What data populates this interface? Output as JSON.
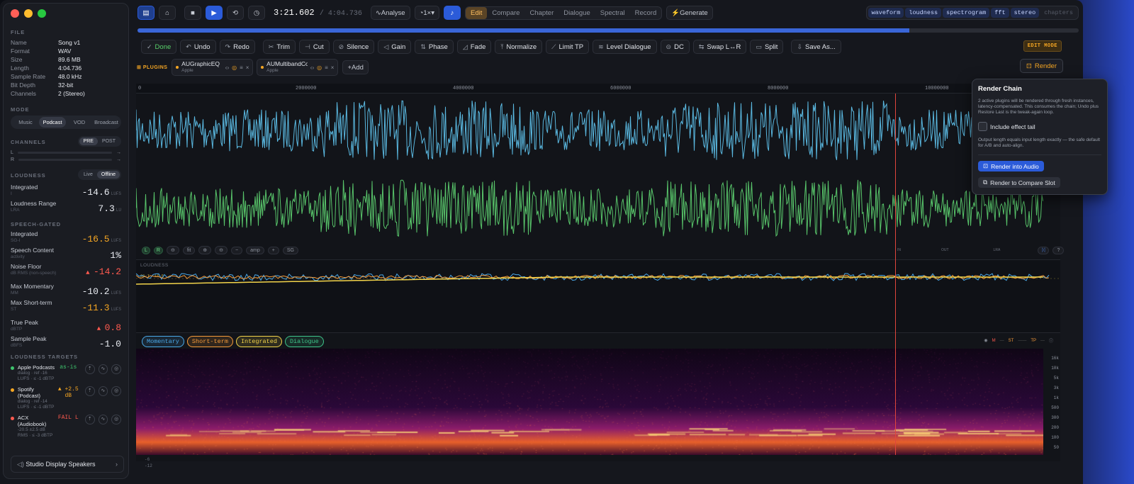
{
  "file": {
    "section": "FILE",
    "rows": [
      {
        "k": "Name",
        "v": "Song v1"
      },
      {
        "k": "Format",
        "v": "WAV"
      },
      {
        "k": "Size",
        "v": "89.6 MB"
      },
      {
        "k": "Length",
        "v": "4:04.736"
      },
      {
        "k": "Sample Rate",
        "v": "48.0 kHz"
      },
      {
        "k": "Bit Depth",
        "v": "32-bit"
      },
      {
        "k": "Channels",
        "v": "2 (Stereo)"
      }
    ]
  },
  "mode": {
    "section": "MODE",
    "options": [
      "Music",
      "Podcast",
      "VOD",
      "Broadcast"
    ],
    "selected": "Podcast"
  },
  "channels": {
    "section": "CHANNELS",
    "pre": "PRE",
    "post": "POST",
    "l": "L",
    "r": "R"
  },
  "loudness": {
    "section": "LOUDNESS",
    "live": "Live",
    "offline": "Offline",
    "integrated": {
      "label": "Integrated",
      "sub": "I",
      "value": "-14.6",
      "unit": "LUFS"
    },
    "range": {
      "label": "Loudness Range",
      "sub": "LRA",
      "value": "7.3",
      "unit": "LU"
    }
  },
  "speech": {
    "section": "SPEECH-GATED",
    "integrated": {
      "label": "Integrated",
      "sub": "SG-I",
      "value": "-16.5",
      "unit": "LUFS"
    },
    "content": {
      "label": "Speech Content",
      "sub": "activity",
      "value": "1%"
    },
    "noise": {
      "label": "Noise Floor",
      "sub": "dB RMS (non-speech)",
      "value": "-14.2"
    },
    "maxmom": {
      "label": "Max Momentary",
      "sub": "MM",
      "value": "-10.2",
      "unit": "LUFS"
    },
    "maxst": {
      "label": "Max Short-term",
      "sub": "ST",
      "value": "-11.3",
      "unit": "LUFS"
    },
    "truepeak": {
      "label": "True Peak",
      "sub": "dBTP",
      "value": "0.8"
    },
    "samplepeak": {
      "label": "Sample Peak",
      "sub": "dBFS",
      "value": "-1.0"
    }
  },
  "targets": {
    "section": "LOUDNESS TARGETS",
    "items": [
      {
        "name": "Apple Podcasts",
        "detail": "dialog · ref -16 LUFS · ≤ -1 dBTP",
        "status": "as-is",
        "color": "#3ec46d"
      },
      {
        "name": "Spotify (Podcast)",
        "detail": "dialog · ref -14 LUFS · ≤ -1 dBTP",
        "status": "+2.5 dB",
        "color": "#f5a623"
      },
      {
        "name": "ACX (Audiobook)",
        "detail": "-20.5 ±2.5 dB RMS · ≤ -3 dBTP",
        "status": "FAIL L",
        "color": "#ff5a4f"
      }
    ]
  },
  "output_device": "Studio Display Speakers",
  "transport": {
    "time": "3:21.602",
    "total": "/ 4:04.736",
    "analyse": "Analyse",
    "speed": "1×"
  },
  "modes": {
    "items": [
      "Edit",
      "Compare",
      "Chapter",
      "Dialogue",
      "Spectral",
      "Record"
    ],
    "selected": "Edit",
    "generate": "Generate"
  },
  "views": {
    "items": [
      "waveform",
      "loudness",
      "spectrogram",
      "fft",
      "stereo",
      "chapters"
    ],
    "off": [
      "chapters"
    ]
  },
  "progress_fraction": 0.82,
  "edit_tools": [
    "Done",
    "Undo",
    "Redo",
    "Trim",
    "Cut",
    "Silence",
    "Gain",
    "Phase",
    "Fade",
    "Normalize",
    "Limit TP",
    "Level Dialogue",
    "DC",
    "Swap L↔R",
    "Split",
    "Save As..."
  ],
  "edit_mode": "EDIT MODE",
  "plugins": {
    "label": "PLUGINS",
    "items": [
      {
        "name": "AUGraphicEQ",
        "vendor": "Apple"
      },
      {
        "name": "AUMultibandCom...",
        "vendor": "Apple"
      }
    ],
    "add": "Add"
  },
  "render_button": "Render",
  "ruler": [
    "0",
    "2000000",
    "4000000",
    "6000000",
    "8000000",
    "10000000"
  ],
  "loudness_panel": {
    "label": "LOUDNESS",
    "tag": "SG-I -16.5"
  },
  "meter_chips": [
    {
      "label": "Momentary",
      "color": "#4aa8e8"
    },
    {
      "label": "Short-term",
      "color": "#f59a3a"
    },
    {
      "label": "Integrated",
      "color": "#f2d34a"
    },
    {
      "label": "Dialogue",
      "color": "#3ec48a"
    }
  ],
  "ctrl": {
    "l": "L",
    "r": "R",
    "fit": "fit",
    "amp": "amp",
    "sg": "SG",
    "in": "IN",
    "out": "OUT",
    "lra": "LRA",
    "m": "M",
    "st": "ST",
    "tp": "TP"
  },
  "freq_axis": [
    "16k",
    "10k",
    "5k",
    "3k",
    "1k",
    "500",
    "300",
    "200",
    "100",
    "50"
  ],
  "bottom_axis": [
    "-6",
    "-12"
  ],
  "popup": {
    "title": "Render Chain",
    "desc": "2 active plugins will be rendered through fresh instances, latency-compensated. This consumes the chain; Undo plus Restore Last is the tweak-again loop.",
    "checkbox": "Include effect tail",
    "note": "Output length equals input length exactly — the safe default for A/B and auto-align.",
    "primary": "Render into Audio",
    "secondary": "Render to Compare Slot"
  }
}
